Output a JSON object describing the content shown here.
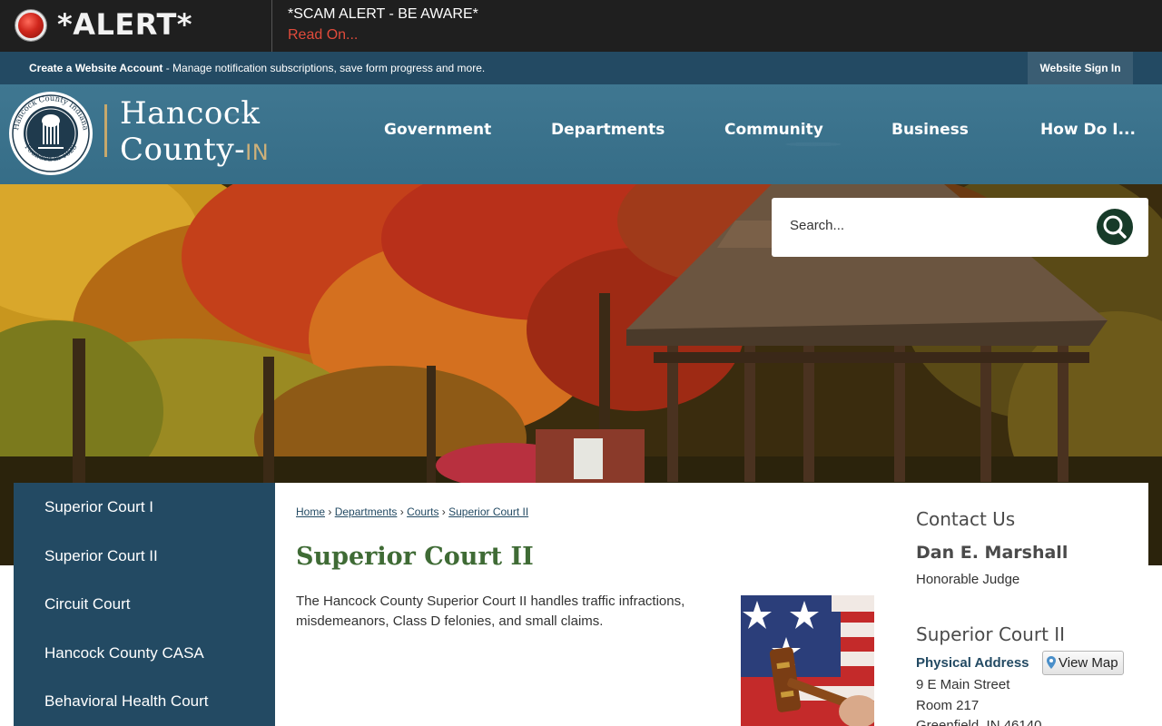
{
  "alert": {
    "title": "*ALERT*",
    "message": "*SCAM ALERT - BE AWARE*",
    "link": "Read On..."
  },
  "account_bar": {
    "create_label": "Create a Website Account",
    "description": " - Manage notification subscriptions, save form progress and more.",
    "signin_label": "Website Sign In"
  },
  "header": {
    "logo_line1": "Hancock",
    "logo_line2": "County-",
    "logo_suffix": "IN",
    "seal_text_top": "Hancock County Indiana",
    "seal_text_bottom": "Founded in 1828",
    "nav": [
      "Government",
      "Departments",
      "Community",
      "Business",
      "How Do I..."
    ]
  },
  "search": {
    "placeholder": "Search..."
  },
  "sidebar": {
    "items": [
      "Superior Court I",
      "Superior Court II",
      "Circuit Court",
      "Hancock County CASA",
      "Behavioral Health Court"
    ]
  },
  "breadcrumb": [
    "Home",
    "Departments",
    "Courts",
    "Superior Court II"
  ],
  "breadcrumb_separator": "›",
  "page": {
    "title": "Superior Court II",
    "intro": "The Hancock County Superior Court II handles traffic infractions, misdemeanors, Class D felonies, and small claims."
  },
  "contact": {
    "heading": "Contact Us",
    "name": "Dan E. Marshall",
    "role": "Honorable Judge",
    "court_heading": "Superior Court II",
    "address_label": "Physical Address",
    "view_map_label": "View Map",
    "address_lines": [
      "9 E Main Street",
      "Room 217",
      "Greenfield, IN 46140"
    ]
  },
  "colors": {
    "alert_bg": "#1f1f1f",
    "alert_link": "#e14b3b",
    "account_bar": "#234a63",
    "header": "#3f7791",
    "sidebar": "#234a63",
    "title_green": "#3f6b35",
    "search_button": "#173b29"
  }
}
